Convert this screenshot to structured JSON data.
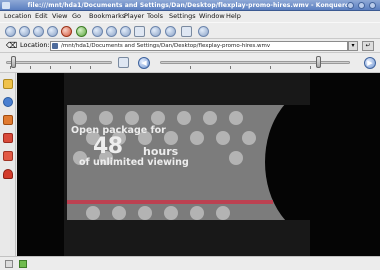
{
  "window": {
    "title": "file:///mnt/hda1/Documents and Settings/Dan/Desktop/flexplay-promo-hires.wmv - Konqueror"
  },
  "menubar": {
    "items": [
      "Location",
      "Edit",
      "View",
      "Go",
      "Bookmarks",
      "Player",
      "Tools",
      "Settings",
      "Window",
      "Help"
    ]
  },
  "toolbar": {
    "icons": [
      "back-icon",
      "forward-icon",
      "up-icon",
      "reload-icon",
      "stop-icon",
      "home-icon",
      "cut-icon",
      "copy-icon",
      "paste-icon",
      "print-icon",
      "zoom-in-icon",
      "zoom-out-icon",
      "volume-icon",
      "konqueror-gear-icon"
    ]
  },
  "location": {
    "label": "Location:",
    "value": "/mnt/hda1/Documents and Settings/Dan/Desktop/flexplay-promo-hires.wmv"
  },
  "player": {
    "position_fraction": 0.05,
    "volume_fraction": 0.82
  },
  "video": {
    "line1": "Open package for",
    "number": "48",
    "unit": "hours",
    "line3": "of unlimited viewing"
  },
  "colors": {
    "accent": "#5b7fc0",
    "video_red_stripe": "#c8374a"
  }
}
